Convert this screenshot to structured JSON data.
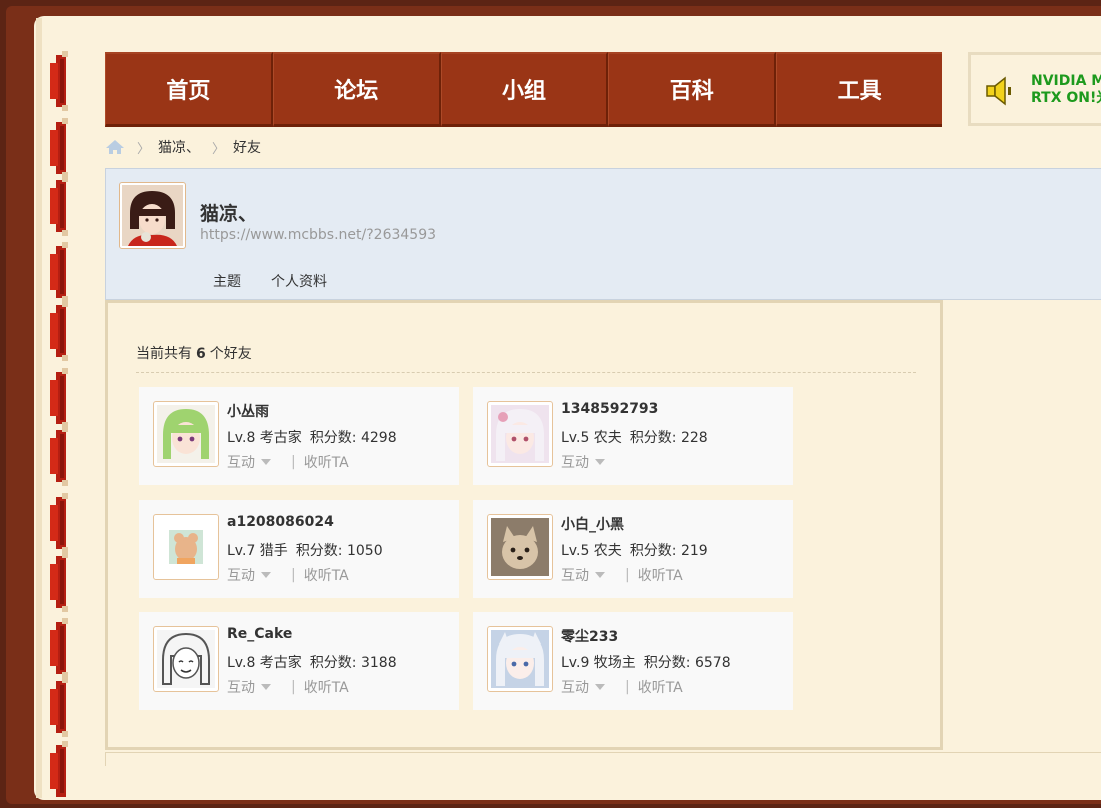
{
  "nav": {
    "items": [
      "首页",
      "论坛",
      "小组",
      "百科",
      "工具"
    ]
  },
  "ad": {
    "line1": "NVIDIA M",
    "line2": "RTX ON!光"
  },
  "breadcrumb": {
    "user": "猫凉、",
    "page": "好友"
  },
  "profile": {
    "name": "猫凉、",
    "url": "https://www.mcbbs.net/?2634593",
    "tabs": [
      "主题",
      "个人资料"
    ]
  },
  "friends": {
    "count_prefix": "当前共有",
    "count": "6",
    "count_suffix": "个好友",
    "interact_label": "互动",
    "listen_label": "收听TA",
    "items": [
      {
        "name": "小丛雨",
        "level": "Lv.8 考古家",
        "score": "积分数: 4298",
        "avatar_color": "#a7d98a"
      },
      {
        "name": "1348592793",
        "level": "Lv.5 农夫",
        "score": "积分数: 228",
        "avatar_color": "#e8d6e6"
      },
      {
        "name": "a1208086024",
        "level": "Lv.7 猎手",
        "score": "积分数: 1050",
        "avatar_color": "#dfe7dd"
      },
      {
        "name": "小白_小黑",
        "level": "Lv.5 农夫",
        "score": "积分数: 219",
        "avatar_color": "#b9a58a"
      },
      {
        "name": "Re_Cake",
        "level": "Lv.8 考古家",
        "score": "积分数: 3188",
        "avatar_color": "#d9d9d9"
      },
      {
        "name": "零尘233",
        "level": "Lv.9 牧场主",
        "score": "积分数: 6578",
        "avatar_color": "#b9c8dd"
      }
    ]
  }
}
